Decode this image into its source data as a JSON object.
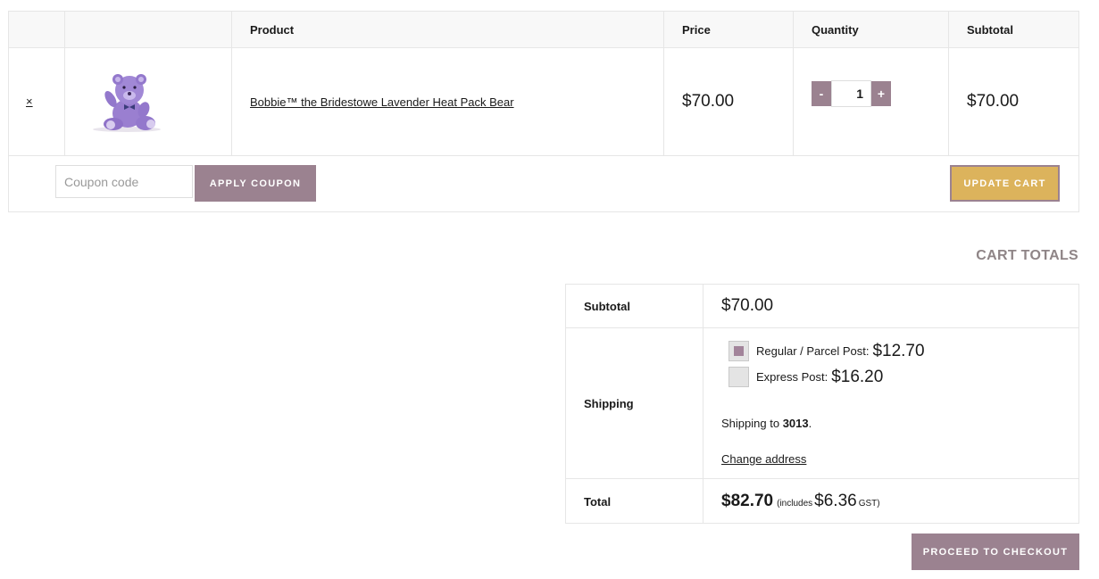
{
  "cart": {
    "headers": {
      "remove": "",
      "thumbnail": "",
      "product": "Product",
      "price": "Price",
      "quantity": "Quantity",
      "subtotal": "Subtotal"
    },
    "item": {
      "remove_symbol": "×",
      "product_name": "Bobbie™ the Bridestowe Lavender Heat Pack Bear",
      "thumbnail_icon": "lavender-teddy-bear-image",
      "price": "$70.00",
      "quantity": "1",
      "qty_minus": "-",
      "qty_plus": "+",
      "subtotal": "$70.00"
    },
    "coupon_placeholder": "Coupon code",
    "apply_coupon_label": "APPLY COUPON",
    "update_cart_label": "UPDATE CART"
  },
  "totals": {
    "title": "CART TOTALS",
    "subtotal_label": "Subtotal",
    "subtotal_value": "$70.00",
    "shipping_label": "Shipping",
    "shipping_options": [
      {
        "label": "Regular / Parcel Post:",
        "price": "$12.70",
        "selected": true
      },
      {
        "label": "Express Post:",
        "price": "$16.20",
        "selected": false
      }
    ],
    "shipping_to_text": "Shipping to",
    "shipping_postcode": "3013",
    "shipping_to_suffix": ".",
    "change_address_label": "Change address",
    "total_label": "Total",
    "total_value": "$82.70",
    "includes_prefix": "(includes",
    "tax_amount": "$6.36",
    "tax_suffix": "GST)"
  },
  "checkout_label": "PROCEED TO CHECKOUT",
  "colors": {
    "accent_mauve": "#9b8290",
    "update_gold": "#dcb35c",
    "totals_title_grey": "#8f8587"
  }
}
